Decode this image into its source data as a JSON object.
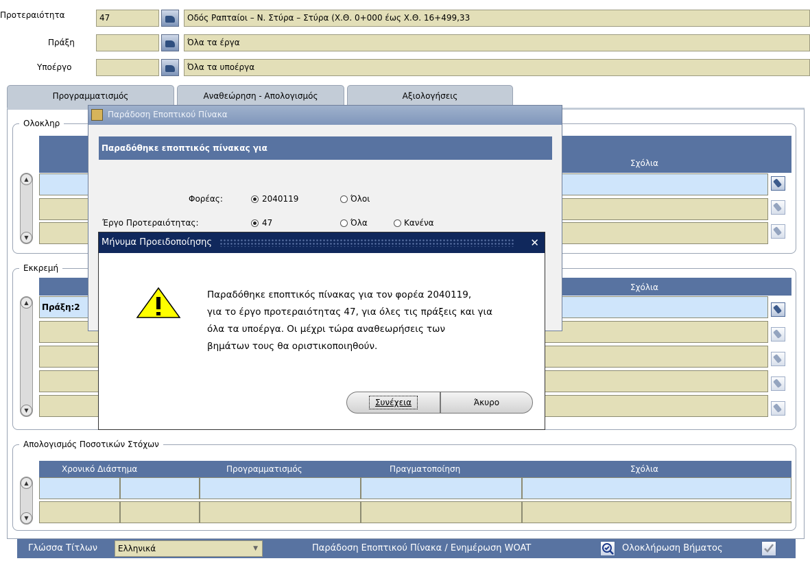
{
  "header": {
    "priority_label": "Προτεραιότητα",
    "priority_code": "47",
    "priority_desc": "Οδός Ραπταίοι – Ν. Στύρα – Στύρα (Χ.Θ. 0+000 έως Χ.Θ. 16+499,33",
    "action_label": "Πράξη",
    "action_code": "",
    "action_desc": "Όλα τα έργα",
    "subproject_label": "Υποέργο",
    "subproject_code": "",
    "subproject_desc": "Όλα τα υποέργα"
  },
  "tabs": [
    {
      "label": "Προγραμματισμός"
    },
    {
      "label": "Αναθεώρηση - Απολογισμός"
    },
    {
      "label": "Αξιολογήσεις"
    }
  ],
  "group_completed": {
    "title": "Ολοκληρ",
    "comments_header": "Σχόλια"
  },
  "group_pending": {
    "title": "Εκκρεμή",
    "comments_header": "Σχόλια",
    "first_row_value": "Πράξη:2"
  },
  "group_targets": {
    "title": "Απολογισμός Ποσοτικών Στόχων",
    "columns": [
      "Χρονικό Διάστημα",
      "Προγραμματισμός",
      "Πραγματοποίηση",
      "Σχόλια"
    ]
  },
  "dialog_supervisory": {
    "title": "Παράδοση Εποπτικού Πίνακα",
    "section_header": "Παραδόθηκε εποπτικός πίνακας για",
    "agency_label": "Φορέας:",
    "agency_value": "2040119",
    "agency_all": "Όλοι",
    "project_label": "Έργο Προτεραιότητας:",
    "project_value": "47",
    "project_all": "Όλα",
    "project_none": "Κανένα"
  },
  "dialog_warning": {
    "title": "Μήνυμα Προειδοποίησης",
    "close": "✕",
    "message_lines": [
      "Παραδόθηκε εποπτικός πίνακας για τον φορέα 2040119,",
      "για το έργο προτεραιότητας 47, για όλες τις πράξεις και για",
      "όλα τα υποέργα. Οι μέχρι τώρα αναθεωρήσεις των",
      "βημάτων τους θα οριστικοποιηθούν."
    ],
    "continue_label": "Συνέχεια",
    "cancel_label": "Άκυρο"
  },
  "bottom": {
    "language_label": "Γλώσσα Τίτλων",
    "language_value": "Ελληνικά",
    "deliver_label": "Παράδοση Εποπτικού Πίνακα / Ενημέρωση WOAT",
    "complete_label": "Ολοκλήρωση Βήματος"
  },
  "colors": {
    "header_blue": "#5873a1",
    "field_khaki": "#e3dfb8",
    "row_blue": "#cfe5fb",
    "dialog_title_navy": "#10285c"
  }
}
